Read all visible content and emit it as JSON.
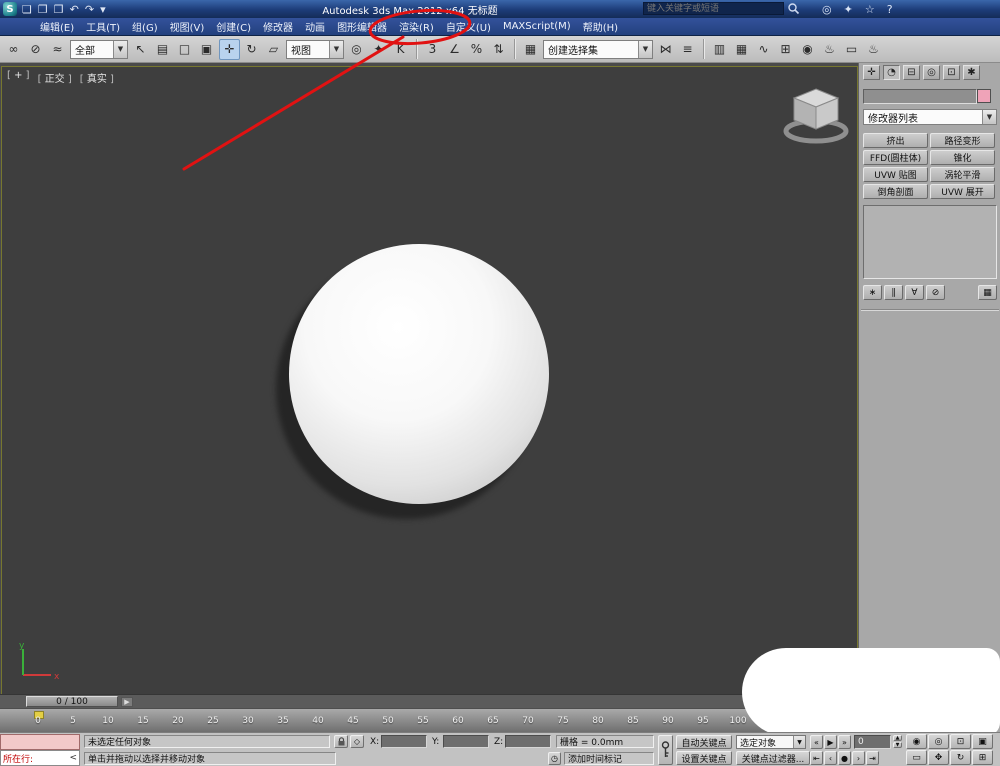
{
  "colors": {
    "annotation_red": "#e11212",
    "object_color_swatch": "#efa3b8",
    "viewport_background": "#3e3e3e",
    "titlebar_blue": "#1d3c78"
  },
  "title_bar": {
    "title": "Autodesk 3ds Max 2012 x64  无标题",
    "search_placeholder": "键入关键字或短语",
    "qat_icons": [
      {
        "name": "new-scene-icon",
        "glyph": "❏"
      },
      {
        "name": "open-file-icon",
        "glyph": "❐"
      },
      {
        "name": "save-file-icon",
        "glyph": "❒"
      },
      {
        "name": "undo-icon",
        "glyph": "↶"
      },
      {
        "name": "redo-icon",
        "glyph": "↷"
      },
      {
        "name": "project-folder-icon",
        "glyph": "▾"
      }
    ],
    "info_icons": [
      {
        "name": "subscription-center-icon",
        "glyph": "◎"
      },
      {
        "name": "communication-center-icon",
        "glyph": "✦"
      },
      {
        "name": "favorites-star-icon",
        "glyph": "☆"
      },
      {
        "name": "help-icon",
        "glyph": "?"
      }
    ]
  },
  "menu_bar": {
    "items": [
      {
        "name": "menu-edit",
        "label": "编辑(E)"
      },
      {
        "name": "menu-tools",
        "label": "工具(T)"
      },
      {
        "name": "menu-group",
        "label": "组(G)"
      },
      {
        "name": "menu-views",
        "label": "视图(V)"
      },
      {
        "name": "menu-create",
        "label": "创建(C)"
      },
      {
        "name": "menu-modifiers",
        "label": "修改器"
      },
      {
        "name": "menu-animation",
        "label": "动画"
      },
      {
        "name": "menu-graph-editors",
        "label": "图形编辑器"
      },
      {
        "name": "menu-rendering",
        "label": "渲染(R)"
      },
      {
        "name": "menu-customize",
        "label": "自定义(U)"
      },
      {
        "name": "menu-maxscript",
        "label": "MAXScript(M)"
      },
      {
        "name": "menu-help",
        "label": "帮助(H)"
      }
    ]
  },
  "annotation": {
    "circled_item": "渲染(R)"
  },
  "toolbar": {
    "selection_filter_value": "全部",
    "coord_system_value": "视图",
    "named_sets_value": "创建选择集",
    "g1": [
      {
        "name": "select-and-link-icon",
        "glyph": "∞"
      },
      {
        "name": "unlink-selection-icon",
        "glyph": "⊘"
      },
      {
        "name": "bind-to-space-warp-icon",
        "glyph": "≈"
      }
    ],
    "g2": [
      {
        "name": "select-object-icon",
        "glyph": "↖"
      },
      {
        "name": "select-by-name-icon",
        "glyph": "▤"
      },
      {
        "name": "rectangular-selection-region-icon",
        "glyph": "□"
      },
      {
        "name": "window-crossing-icon",
        "glyph": "▣"
      }
    ],
    "g3": [
      {
        "name": "select-and-move-icon",
        "glyph": "✛",
        "active": true
      },
      {
        "name": "select-and-rotate-icon",
        "glyph": "↻"
      },
      {
        "name": "select-and-scale-icon",
        "glyph": "▱"
      }
    ],
    "g4": [
      {
        "name": "use-pivot-point-center-icon",
        "glyph": "◎"
      },
      {
        "name": "select-and-manipulate-icon",
        "glyph": "✦"
      },
      {
        "name": "keyboard-shortcut-override-icon",
        "glyph": "K"
      }
    ],
    "g5": [
      {
        "name": "snap-toggle-3d-icon",
        "glyph": "3"
      },
      {
        "name": "angle-snap-icon",
        "glyph": "∠"
      },
      {
        "name": "percent-snap-icon",
        "glyph": "%"
      },
      {
        "name": "spinner-snap-icon",
        "glyph": "⇅"
      }
    ],
    "g6": [
      {
        "name": "edit-named-selection-sets-icon",
        "glyph": "▦"
      }
    ],
    "g7": [
      {
        "name": "mirror-icon",
        "glyph": "⋈"
      },
      {
        "name": "align-icon",
        "glyph": "≡"
      }
    ],
    "g8": [
      {
        "name": "manage-layers-icon",
        "glyph": "▥"
      },
      {
        "name": "graphite-ribbon-icon",
        "glyph": "▦"
      },
      {
        "name": "curve-editor-icon",
        "glyph": "∿"
      },
      {
        "name": "schematic-view-icon",
        "glyph": "⊞"
      },
      {
        "name": "material-editor-icon",
        "glyph": "◉"
      },
      {
        "name": "render-setup-icon",
        "glyph": "♨"
      },
      {
        "name": "rendered-frame-window-icon",
        "glyph": "▭"
      },
      {
        "name": "render-production-icon",
        "glyph": "♨"
      }
    ]
  },
  "viewport": {
    "label_plus": "+",
    "label_view_type": "正交",
    "label_shading": "真实",
    "axis_x_label": "x",
    "axis_y_label": "y"
  },
  "timeline": {
    "slider_label": "0 / 100",
    "next_frame_glyph": "▶"
  },
  "ruler": {
    "numbers": [
      "0",
      "5",
      "10",
      "15",
      "20",
      "25",
      "30",
      "35",
      "40",
      "45",
      "50",
      "55",
      "60",
      "65",
      "70",
      "75",
      "80",
      "85",
      "90",
      "95",
      "100"
    ]
  },
  "command_panel": {
    "tabs": [
      {
        "name": "create-tab",
        "glyph": "✛"
      },
      {
        "name": "modify-tab",
        "glyph": "◔",
        "active": true
      },
      {
        "name": "hierarchy-tab",
        "glyph": "⊟"
      },
      {
        "name": "motion-tab",
        "glyph": "◎"
      },
      {
        "name": "display-tab",
        "glyph": "⊡"
      },
      {
        "name": "utilities-tab",
        "glyph": "✱"
      }
    ],
    "object_name_value": "",
    "modifier_list_label": "修改器列表",
    "modifier_buttons": [
      {
        "name": "modifier-extrude-button",
        "label": "挤出"
      },
      {
        "name": "modifier-path-deform-button",
        "label": "路径变形"
      },
      {
        "name": "modifier-ffd-cylinder-button",
        "label": "FFD(圆柱体)"
      },
      {
        "name": "modifier-taper-button",
        "label": "锥化"
      },
      {
        "name": "modifier-uvw-map-button",
        "label": "UVW 贴图"
      },
      {
        "name": "modifier-turbosmooth-button",
        "label": "涡轮平滑"
      },
      {
        "name": "modifier-bevel-profile-button",
        "label": "倒角剖面"
      },
      {
        "name": "modifier-unwrap-uvw-button",
        "label": "UVW 展开"
      }
    ],
    "stack_tools": [
      {
        "name": "pin-stack-icon",
        "glyph": "∗"
      },
      {
        "name": "show-end-result-icon",
        "glyph": "∥"
      },
      {
        "name": "make-unique-icon",
        "glyph": "∀"
      },
      {
        "name": "remove-modifier-icon",
        "glyph": "⊘"
      },
      {
        "name": "configure-modifier-sets-icon",
        "glyph": "▦"
      }
    ]
  },
  "status_bar": {
    "listener_prompt": "所在行:",
    "listener_collapse_glyph": "<",
    "status_line": "未选定任何对象",
    "prompt_line": "单击并拖动以选择并移动对象",
    "x_label": "X:",
    "y_label": "Y:",
    "z_label": "Z:",
    "grid_size": "栅格 = 0.0mm",
    "add_time_tag": "添加时间标记",
    "auto_key_label": "自动关键点",
    "set_key_label": "设置关键点",
    "key_filter_selected": "选定对象",
    "key_filters_label": "关键点过滤器...",
    "frame_number": "0",
    "transport_row1": [
      {
        "name": "previous-key-button",
        "glyph": "«"
      },
      {
        "name": "play-button",
        "glyph": "▶"
      },
      {
        "name": "next-key-button",
        "glyph": "»"
      }
    ],
    "transport_row2": [
      {
        "name": "go-to-start-button",
        "glyph": "⇤"
      },
      {
        "name": "previous-frame-button",
        "glyph": "‹"
      },
      {
        "name": "key-mode-toggle-button",
        "glyph": "●"
      },
      {
        "name": "next-frame-button",
        "glyph": "›"
      },
      {
        "name": "go-to-end-button",
        "glyph": "⇥"
      }
    ],
    "viewport_nav": [
      {
        "name": "zoom-icon",
        "glyph": "◉"
      },
      {
        "name": "zoom-all-icon",
        "glyph": "◎"
      },
      {
        "name": "zoom-extents-icon",
        "glyph": "⊡"
      },
      {
        "name": "zoom-extents-all-icon",
        "glyph": "▣"
      },
      {
        "name": "zoom-region-icon",
        "glyph": "▭"
      },
      {
        "name": "pan-view-icon",
        "glyph": "✥"
      },
      {
        "name": "orbit-icon",
        "glyph": "↻"
      },
      {
        "name": "maximize-viewport-toggle-icon",
        "glyph": "⊞"
      }
    ]
  }
}
